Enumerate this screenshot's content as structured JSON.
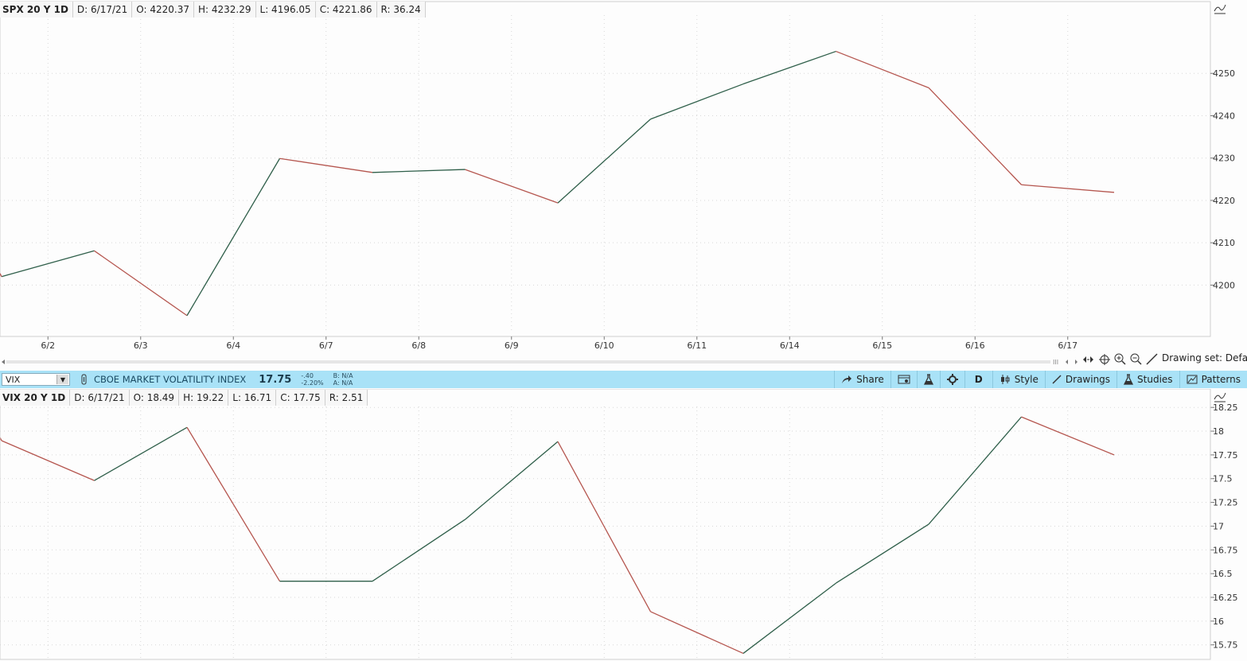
{
  "top_header": {
    "symbol": "SPX 20 Y 1D",
    "date": "D: 6/17/21",
    "open": "O: 4220.37",
    "high": "H: 4232.29",
    "low": "L: 4196.05",
    "close": "C: 4221.86",
    "range": "R: 36.24"
  },
  "bottom_header": {
    "symbol": "VIX 20 Y 1D",
    "date": "D: 6/17/21",
    "open": "O: 18.49",
    "high": "H: 19.22",
    "low": "L: 16.71",
    "close": "C: 17.75",
    "range": "R: 2.51"
  },
  "toolbar": {
    "symbol_value": "VIX",
    "instrument_name": "CBOE MARKET VOLATILITY INDEX",
    "last_price": "17.75",
    "net_change": "-.40",
    "pct_change": "-2.20%",
    "bid": "B: N/A",
    "ask": "A: N/A",
    "share_label": "Share",
    "aggregation_label": "D",
    "style_label": "Style",
    "drawings_label": "Drawings",
    "studies_label": "Studies",
    "patterns_label": "Patterns"
  },
  "drawing_set_label": "Drawing set: Defau",
  "colors": {
    "up": "#2f5f4a",
    "down": "#b5564f",
    "toolbar_bg": "#a9e2f7"
  },
  "chart_data": [
    {
      "type": "line",
      "symbol": "SPX",
      "x": [
        "6/1",
        "6/2",
        "6/3",
        "6/4",
        "6/7",
        "6/8",
        "6/9",
        "6/10",
        "6/11",
        "6/14",
        "6/15",
        "6/16",
        "6/17"
      ],
      "x_tick_labels": [
        "6/2",
        "6/3",
        "6/4",
        "6/7",
        "6/8",
        "6/9",
        "6/10",
        "6/11",
        "6/14",
        "6/15",
        "6/16",
        "6/17"
      ],
      "y": [
        4202.0,
        4208.1,
        4192.8,
        4229.9,
        4226.6,
        4227.3,
        4219.4,
        4239.2,
        4247.5,
        4255.2,
        4246.6,
        4223.7,
        4221.9
      ],
      "y_tick_labels": [
        "4200",
        "4210",
        "4220",
        "4230",
        "4240",
        "4250"
      ],
      "ylim": [
        4190.5,
        4260
      ],
      "grid": true
    },
    {
      "type": "line",
      "symbol": "VIX",
      "x": [
        "6/1",
        "6/2",
        "6/3",
        "6/4",
        "6/7",
        "6/8",
        "6/9",
        "6/10",
        "6/11",
        "6/14",
        "6/15",
        "6/16",
        "6/17"
      ],
      "y": [
        17.9,
        17.48,
        18.04,
        16.42,
        16.42,
        17.07,
        17.89,
        16.1,
        15.66,
        16.4,
        17.02,
        18.15,
        17.75
      ],
      "y_tick_labels": [
        "15.75",
        "16",
        "16.25",
        "16.5",
        "16.75",
        "17",
        "17.25",
        "17.5",
        "17.75",
        "18",
        "18.25"
      ],
      "ylim": [
        15.58,
        18.26
      ],
      "grid": true
    }
  ]
}
